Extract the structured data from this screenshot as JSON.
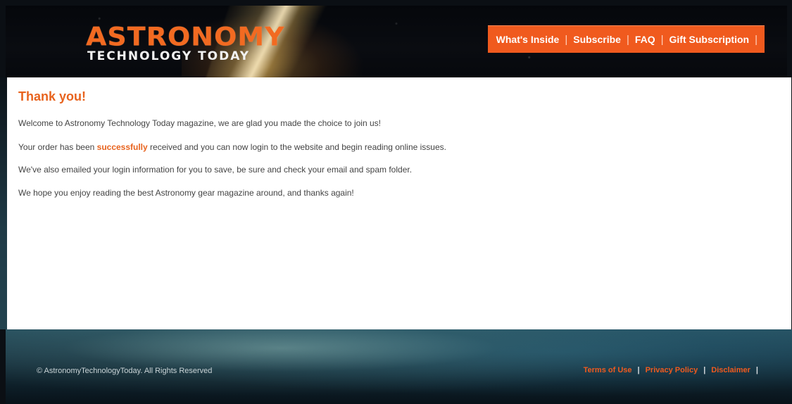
{
  "header": {
    "logo_main": "ASTRONOMY",
    "logo_sub": "TECHNOLOGY TODAY",
    "nav": [
      {
        "label": "What's Inside"
      },
      {
        "label": "Subscribe"
      },
      {
        "label": "FAQ"
      },
      {
        "label": "Gift Subscription"
      }
    ],
    "separator": "|"
  },
  "main": {
    "title": "Thank you!",
    "p1": "Welcome to Astronomy Technology Today magazine, we are glad you made the choice to join us!",
    "p2_before": "Your order has been ",
    "p2_highlight": "successfully",
    "p2_after": " received and you can now login to the website and begin reading online issues.",
    "p3": "We've also emailed your login information for you to save, be sure and check your email and spam folder.",
    "p4": "We hope you enjoy reading the best Astronomy gear magazine around, and thanks again!"
  },
  "footer": {
    "copyright": "© AstronomyTechnologyToday. All Rights Reserved",
    "links": [
      {
        "label": "Terms of Use"
      },
      {
        "label": "Privacy Policy"
      },
      {
        "label": "Disclaimer"
      }
    ],
    "separator": "|"
  },
  "colors": {
    "accent": "#f05a1e",
    "highlight_text": "#e8631e",
    "body_text": "#444444"
  }
}
